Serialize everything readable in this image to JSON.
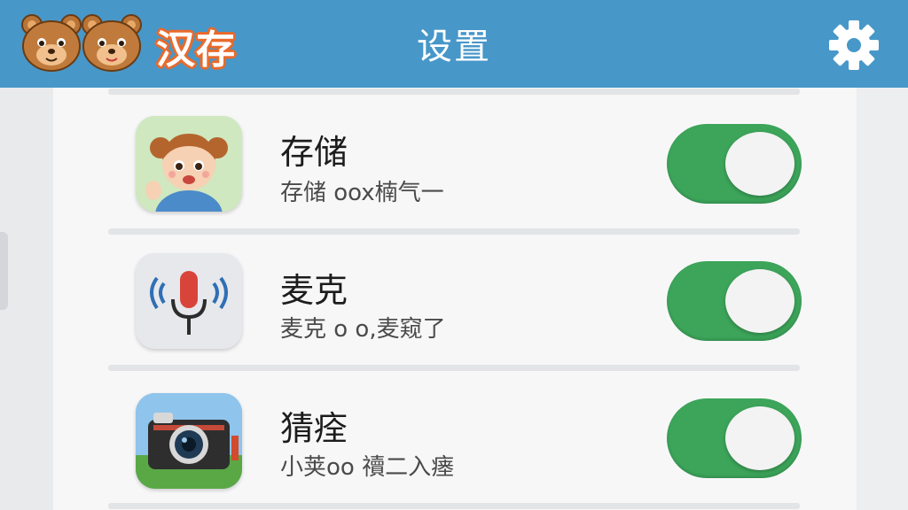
{
  "header": {
    "logo_text": "汉存",
    "title": "设置",
    "settings_icon": "gear-icon"
  },
  "colors": {
    "header_bg": "#4797c9",
    "toggle_on": "#3ca55a",
    "logo_outline": "#e96a2a"
  },
  "settings": [
    {
      "title": "存储",
      "subtitle": "存储 oox楠气一",
      "icon": "child-avatar-icon",
      "toggle_on": true
    },
    {
      "title": "麦克",
      "subtitle": "麦克 o o,麦窥了",
      "icon": "microphone-icon",
      "toggle_on": true
    },
    {
      "title": "猜痊",
      "subtitle": "小荚oo 䄣二入瘗",
      "icon": "camera-icon",
      "toggle_on": true
    }
  ]
}
